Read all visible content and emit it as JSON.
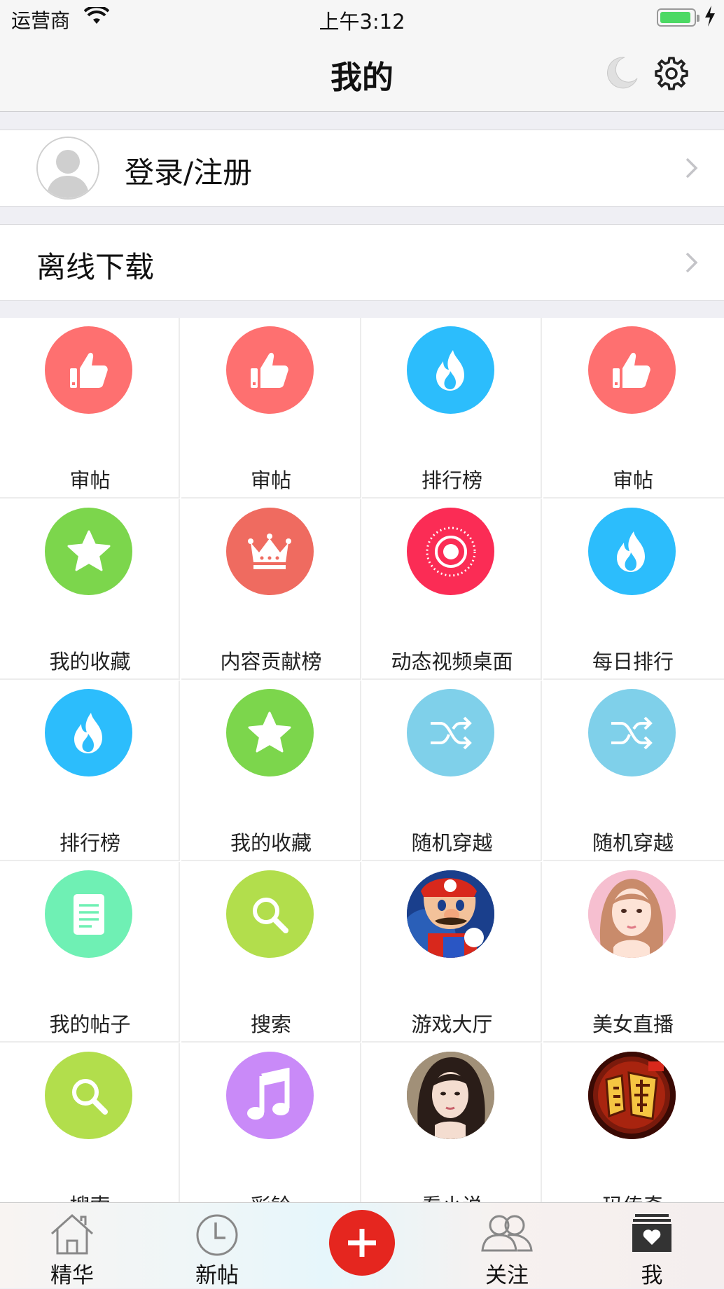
{
  "status_bar": {
    "carrier": "运营商",
    "time": "上午3:12",
    "battery_percent": 100
  },
  "nav": {
    "title": "我的",
    "moon_icon": "moon-icon",
    "settings_icon": "gear-icon"
  },
  "account": {
    "login_label": "登录/注册"
  },
  "offline": {
    "label": "离线下载"
  },
  "grid": [
    {
      "label": "审帖",
      "icon": "thumbs-up-icon",
      "color": "#fe7070"
    },
    {
      "label": "审帖",
      "icon": "thumbs-up-icon",
      "color": "#fe7070"
    },
    {
      "label": "排行榜",
      "icon": "flame-icon",
      "color": "#2cbdfc"
    },
    {
      "label": "审帖",
      "icon": "thumbs-up-icon",
      "color": "#fe7070"
    },
    {
      "label": "我的收藏",
      "icon": "star-icon",
      "color": "#7cd64c"
    },
    {
      "label": "内容贡献榜",
      "icon": "crown-icon",
      "color": "#ef6b60"
    },
    {
      "label": "动态视频桌面",
      "icon": "record-icon",
      "color": "#fb2c55"
    },
    {
      "label": "每日排行",
      "icon": "flame-icon",
      "color": "#2cbdfc"
    },
    {
      "label": "排行榜",
      "icon": "flame-icon",
      "color": "#2cbdfc"
    },
    {
      "label": "我的收藏",
      "icon": "star-icon",
      "color": "#7cd64c"
    },
    {
      "label": "随机穿越",
      "icon": "shuffle-icon",
      "color": "#7fd0ea"
    },
    {
      "label": "随机穿越",
      "icon": "shuffle-icon",
      "color": "#7fd0ea"
    },
    {
      "label": "我的帖子",
      "icon": "document-icon",
      "color": "#6ff0b4"
    },
    {
      "label": "搜索",
      "icon": "search-icon",
      "color": "#b2de4c"
    },
    {
      "label": "游戏大厅",
      "icon": "game-avatar-icon",
      "color": "#1a3f8c"
    },
    {
      "label": "美女直播",
      "icon": "girl-avatar-icon",
      "color": "#f6bfd0"
    },
    {
      "label": "搜索",
      "icon": "search-icon",
      "color": "#b2de4c"
    },
    {
      "label": "彩铃",
      "icon": "music-note-icon",
      "color": "#c98af8"
    },
    {
      "label": "看小说",
      "icon": "novel-avatar-icon",
      "color": "#8a7a66"
    },
    {
      "label": "玛传奇",
      "icon": "legend-logo-icon",
      "color": "#7a1a0c"
    }
  ],
  "tabs": [
    {
      "label": "精华",
      "icon": "home-icon"
    },
    {
      "label": "新帖",
      "icon": "clock-icon"
    },
    {
      "label": "",
      "icon": "plus-icon"
    },
    {
      "label": "关注",
      "icon": "people-icon"
    },
    {
      "label": "我",
      "icon": "heart-box-icon"
    }
  ],
  "colors": {
    "accent_red": "#e5261f",
    "background": "#efeff4"
  }
}
